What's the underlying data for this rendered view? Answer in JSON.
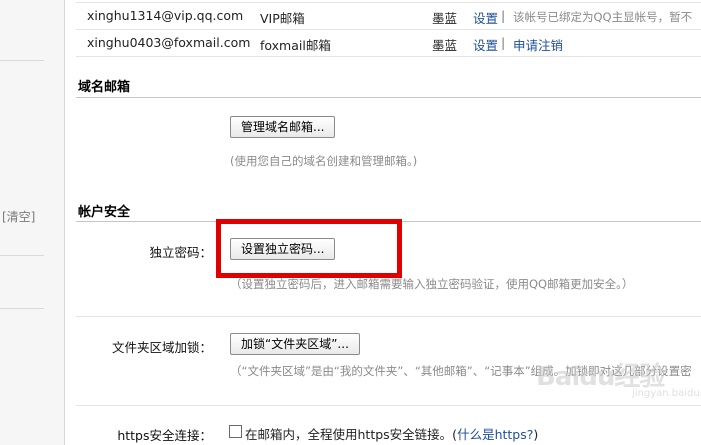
{
  "sidebar": {
    "clear_label": "[清空]"
  },
  "accounts": [
    {
      "email": "xinghu1314@vip.qq.com",
      "type": "VIP邮箱",
      "color": "墨蓝",
      "settings": "设置",
      "separator": "|",
      "note": "该帐号已绑定为QQ主显帐号，暂不"
    },
    {
      "email": "xinghu0403@foxmail.com",
      "type": "foxmail邮箱",
      "color": "墨蓝",
      "settings": "设置",
      "separator": "|",
      "note": "申请注销"
    }
  ],
  "domain_mail": {
    "title": "域名邮箱",
    "button": "管理域名邮箱...",
    "hint": "(使用您自己的域名创建和管理邮箱。)"
  },
  "account_security": {
    "title": "帐户安全",
    "password_label": "独立密码：",
    "password_button": "设置独立密码...",
    "password_hint": "（设置独立密码后，进入邮箱需要输入独立密码验证，使用QQ邮箱更加安全。）",
    "folder_lock_label": "文件夹区域加锁：",
    "folder_lock_button": "加锁“文件夹区域”...",
    "folder_lock_hint": "（“文件夹区域”是由“我的文件夹”、“其他邮箱”、“记事本”组成。加锁即对这几部分设置密",
    "https_label": "https安全连接：",
    "https_checkbox_text": "在邮箱内，全程使用https安全链接。(",
    "https_link": "什么是https?",
    "https_close": ")"
  },
  "watermark": {
    "text": "Baidu经验",
    "sub": "jingyan.baidu.com"
  },
  "colors": {
    "highlight": "#e00000",
    "link": "#1f4f9a"
  }
}
